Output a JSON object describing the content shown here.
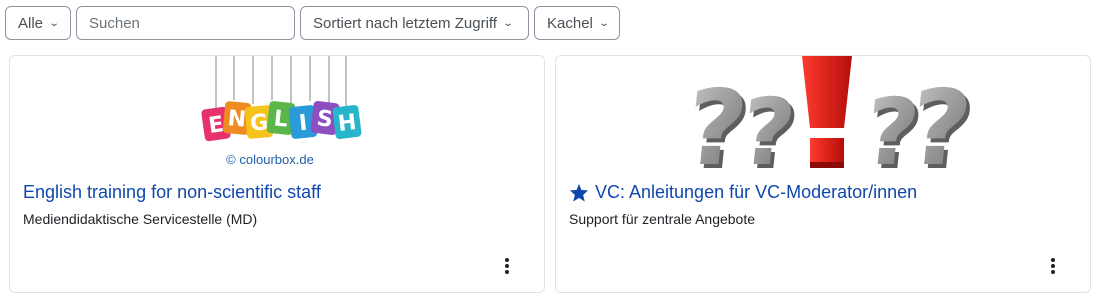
{
  "filters": {
    "grouping": "Alle",
    "search_placeholder": "Suchen",
    "sort": "Sortiert nach letztem Zugriff",
    "view": "Kachel"
  },
  "courses": [
    {
      "title": "English training for non-scientific staff",
      "category": "Mediendidaktische Servicestelle (MD)",
      "image_letters": [
        "E",
        "N",
        "G",
        "L",
        "I",
        "S",
        "H"
      ],
      "image_credit": "© colourbox.de",
      "starred": false
    },
    {
      "title": "VC: Anleitungen für VC-Moderator/innen",
      "category": "Support für zentrale Angebote",
      "starred": true
    }
  ],
  "colors": {
    "link": "#0f47ad",
    "star": "#0f47ad",
    "border": "#dee2e6",
    "exclamation": "#e0201c"
  }
}
